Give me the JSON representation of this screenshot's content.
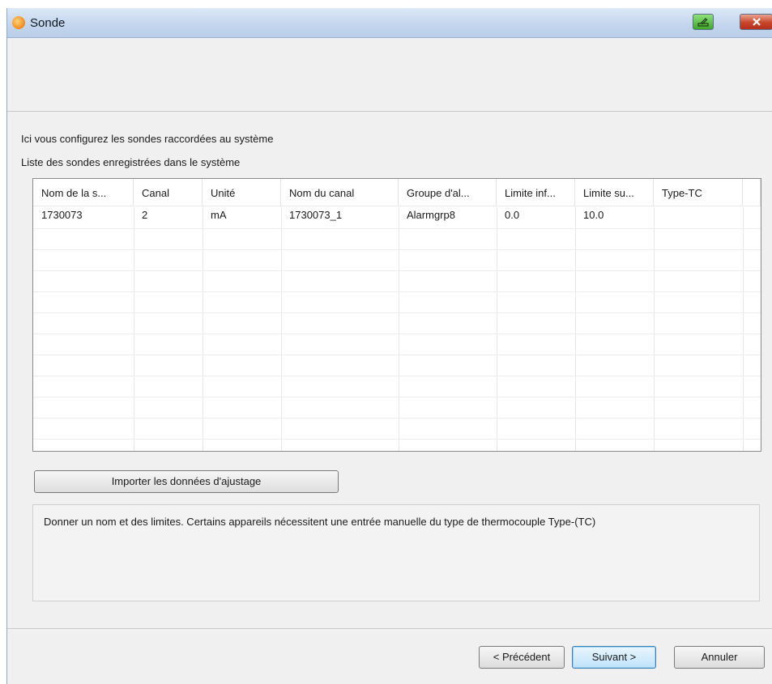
{
  "window": {
    "title": "Sonde"
  },
  "descriptions": {
    "line1": "Ici vous configurez les sondes raccordées au système",
    "line2": "Liste des sondes enregistrées dans le système"
  },
  "table": {
    "columns": [
      "Nom de la s...",
      "Canal",
      "Unité",
      "Nom du canal",
      "Groupe d'al...",
      "Limite inf...",
      "Limite su...",
      "Type-TC"
    ],
    "rows": [
      [
        "1730073",
        "2",
        "mA",
        "1730073_1",
        "Alarmgrp8",
        "0.0",
        "10.0",
        ""
      ]
    ]
  },
  "buttons": {
    "import": "Importer les données d'ajustage",
    "previous": "< Précédent",
    "next": "Suivant >",
    "cancel": "Annuler"
  },
  "info": {
    "text": "Donner un nom et des limites. Certains appareils nécessitent une entrée manuelle du type de thermocouple Type-(TC)"
  },
  "colors": {
    "title_bar": "#c5d7ee",
    "close_button": "#c8452b",
    "accent_button": "#bfe3fb"
  },
  "icons": [
    "app-logo-icon",
    "edit-icon",
    "close-icon"
  ]
}
